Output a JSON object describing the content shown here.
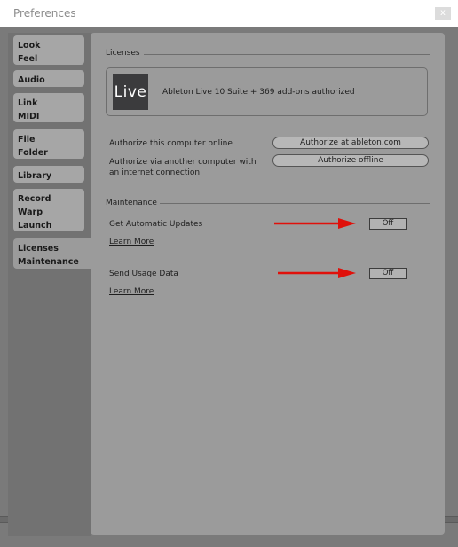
{
  "window": {
    "title": "Preferences",
    "close_label": "x"
  },
  "sidebar": {
    "tabs": [
      {
        "lines": [
          "Look",
          "Feel"
        ]
      },
      {
        "lines": [
          "Audio"
        ]
      },
      {
        "lines": [
          "Link",
          "MIDI"
        ]
      },
      {
        "lines": [
          "File",
          "Folder"
        ]
      },
      {
        "lines": [
          "Library"
        ]
      },
      {
        "lines": [
          "Record",
          "Warp",
          "Launch"
        ]
      },
      {
        "lines": [
          "Licenses",
          "Maintenance"
        ],
        "active": true
      }
    ]
  },
  "licenses": {
    "heading": "Licenses",
    "logo_text": "Live",
    "status": "Ableton Live 10 Suite + 369 add-ons authorized",
    "authorize_online_label": "Authorize this computer online",
    "authorize_online_button": "Authorize at ableton.com",
    "authorize_offline_label_1": "Authorize via another computer with",
    "authorize_offline_label_2": "an internet connection",
    "authorize_offline_button": "Authorize offline"
  },
  "maintenance": {
    "heading": "Maintenance",
    "auto_updates_label": "Get Automatic Updates",
    "auto_updates_value": "Off",
    "auto_updates_learn": "Learn More",
    "usage_data_label": "Send Usage Data",
    "usage_data_value": "Off",
    "usage_data_learn": "Learn More"
  },
  "colors": {
    "arrow": "#e0100a"
  }
}
